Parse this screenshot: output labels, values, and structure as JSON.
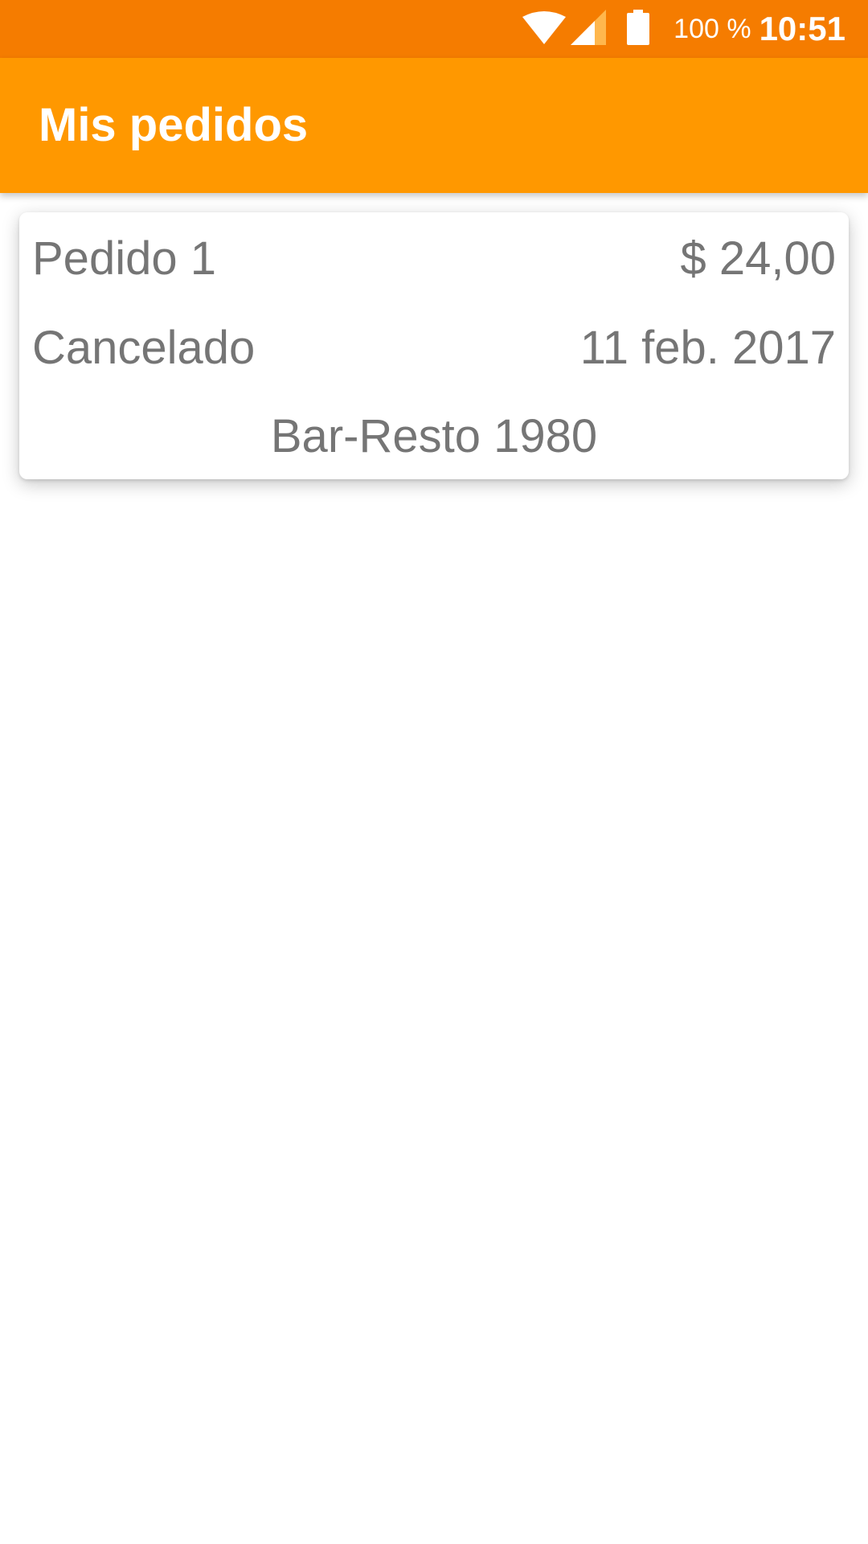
{
  "status_bar": {
    "battery_text": "100 %",
    "time": "10:51",
    "icons": [
      "wifi-icon",
      "signal-icon",
      "battery-icon"
    ],
    "background_color": "#F57C00"
  },
  "app_bar": {
    "title": "Mis pedidos",
    "background_color": "#FF9800"
  },
  "orders": [
    {
      "name": "Pedido 1",
      "price": "$ 24,00",
      "status": "Cancelado",
      "date": "11 feb. 2017",
      "venue": "Bar-Resto 1980"
    }
  ]
}
